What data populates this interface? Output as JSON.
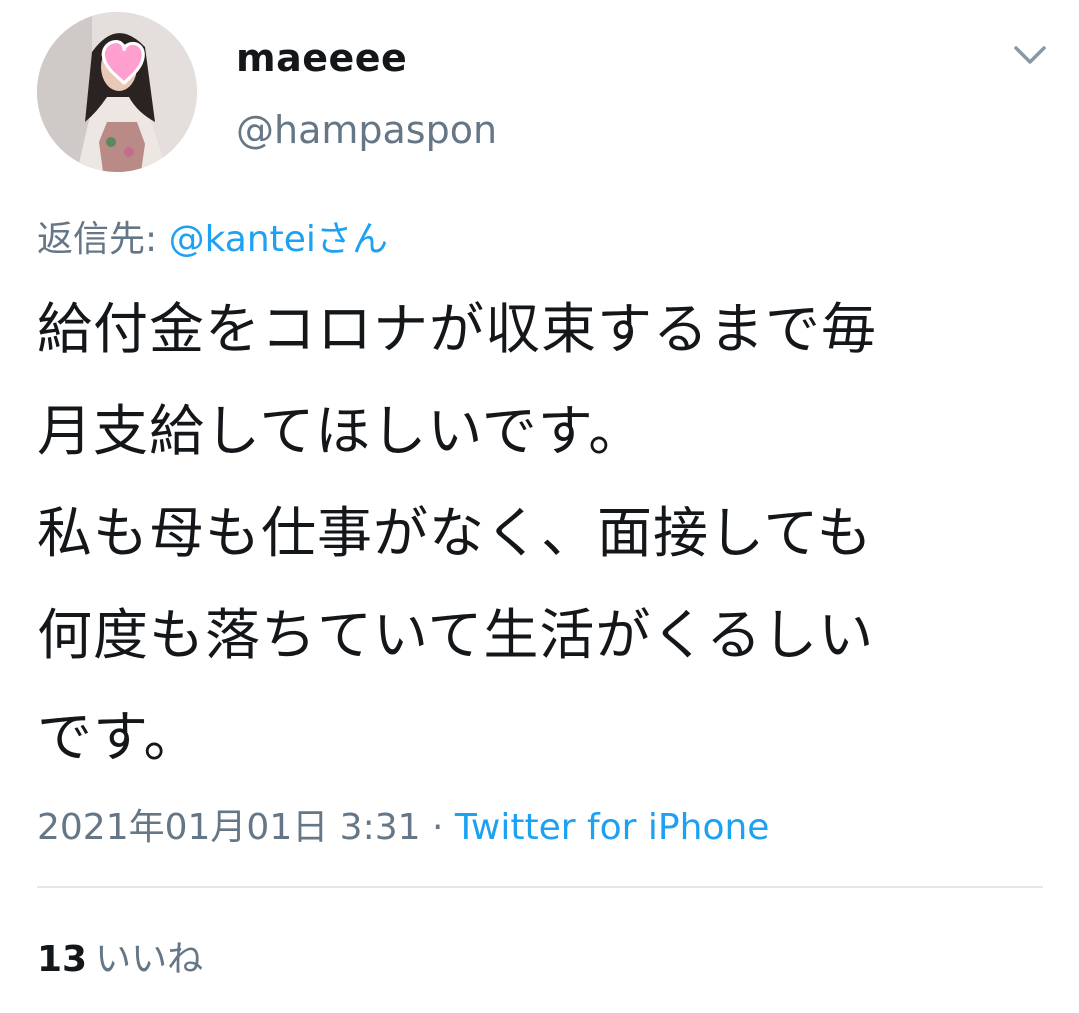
{
  "tweet": {
    "display_name": "maeeee",
    "handle": "@hampaspon",
    "reply_prefix": "返信先: ",
    "reply_mention": "@kantei",
    "reply_suffix": "さん",
    "body_lines": [
      "給付金をコロナが収束するまで毎",
      "月支給してほしいです。",
      "私も母も仕事がなく、面接しても",
      "何度も落ちていて生活がくるしい",
      "です。"
    ],
    "timestamp": "2021年01月01日 3:31",
    "separator": " · ",
    "source": "Twitter for iPhone",
    "likes_count": "13",
    "likes_label": "いいね"
  },
  "icons": {
    "avatar": "profile-photo",
    "menu": "chevron-down-icon"
  },
  "colors": {
    "text": "#14171a",
    "secondary": "#657786",
    "link": "#1da1f2",
    "divider": "#e1e8ed",
    "sticker": "#ff9fd0"
  }
}
